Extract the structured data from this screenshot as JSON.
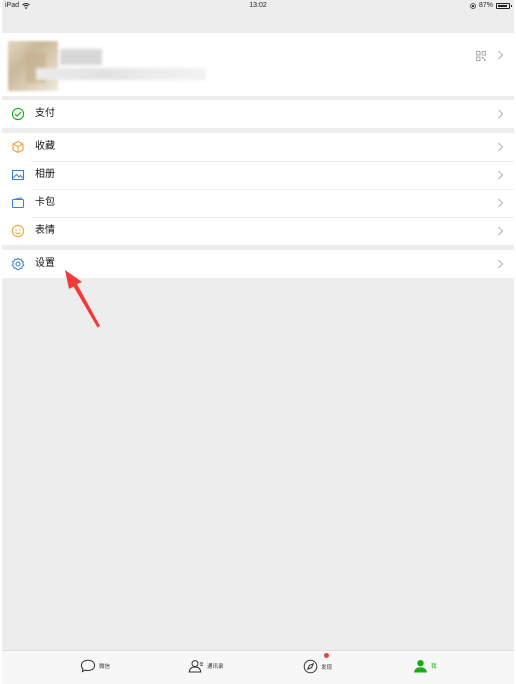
{
  "status_bar": {
    "device": "iPad",
    "time": "13:02",
    "battery": "87%"
  },
  "profile": {
    "qr_icon": "qr-code-icon",
    "chevron": "chevron-right-icon"
  },
  "menu": {
    "pay": {
      "label": "支付",
      "icon": "wallet-icon",
      "color": "#1aad19"
    },
    "favorites": {
      "label": "收藏",
      "icon": "cube-icon",
      "color": "#f0a23c"
    },
    "album": {
      "label": "相册",
      "icon": "image-icon",
      "color": "#3e7fd1"
    },
    "cards": {
      "label": "卡包",
      "icon": "card-icon",
      "color": "#3e7fd1"
    },
    "stickers": {
      "label": "表情",
      "icon": "smiley-icon",
      "color": "#f0a23c"
    },
    "settings": {
      "label": "设置",
      "icon": "gear-icon",
      "color": "#3e7fd1"
    }
  },
  "tabs": [
    {
      "label": "微信",
      "icon": "chat-bubble-icon"
    },
    {
      "label": "通讯录",
      "icon": "contacts-icon"
    },
    {
      "label": "发现",
      "icon": "compass-icon",
      "badge": true
    },
    {
      "label": "我",
      "icon": "person-icon",
      "active": true
    }
  ],
  "colors": {
    "accent_green": "#1aad19",
    "background": "#ededed",
    "annotation_red": "#f23a3a"
  }
}
